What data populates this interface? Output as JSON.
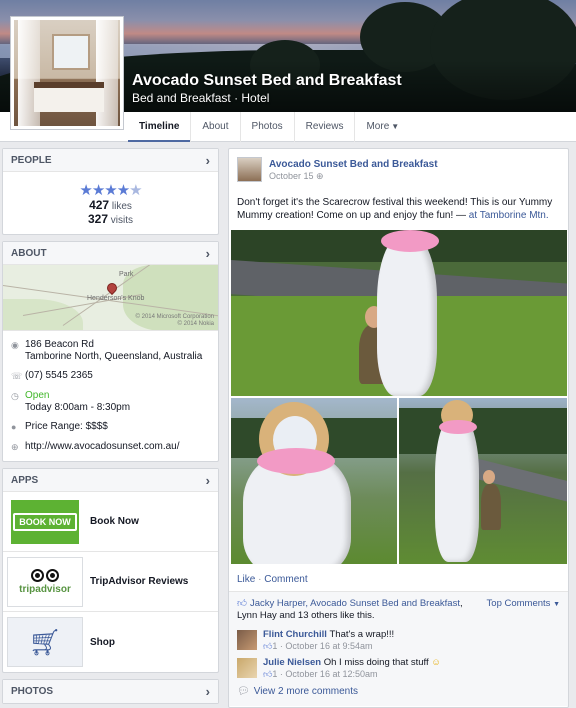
{
  "page": {
    "name": "Avocado Sunset Bed and Breakfast",
    "category": "Bed and Breakfast · Hotel"
  },
  "tabs": [
    "Timeline",
    "About",
    "Photos",
    "Reviews",
    "More"
  ],
  "people": {
    "header": "PEOPLE",
    "rating_stars": 4.5,
    "likes_count": "427",
    "likes_label": "likes",
    "visits_count": "327",
    "visits_label": "visits"
  },
  "about": {
    "header": "ABOUT",
    "map_labels": [
      "Park",
      "Henderson's Knob"
    ],
    "map_copyright": "© 2014 Microsoft Corporation\n© 2014 Nokia",
    "address_line1": "186 Beacon Rd",
    "address_line2": "Tamborine North, Queensland, Australia",
    "phone": "(07) 5545 2365",
    "open_label": "Open",
    "hours": "Today 8:00am - 8:30pm",
    "price_range": "Price Range: $$$$",
    "website": "http://www.avocadosunset.com.au/"
  },
  "apps": {
    "header": "APPS",
    "items": [
      {
        "label": "Book Now",
        "thumb_text": "BOOK NOW",
        "icon": "book-now-icon"
      },
      {
        "label": "TripAdvisor Reviews",
        "thumb_text": "tripadvisor",
        "icon": "tripadvisor-owl-icon"
      },
      {
        "label": "Shop",
        "icon": "shopping-cart-icon"
      }
    ]
  },
  "photos_header": "PHOTOS",
  "post": {
    "author": "Avocado Sunset Bed and Breakfast",
    "date": "October 15",
    "text": "Don't forget it's the Scarecrow festival this weekend! This is our Yummy Mummy creation! Come on up and enjoy the fun! — ",
    "location": "at Tamborine Mtn.",
    "like_action": "Like",
    "comment_action": "Comment",
    "likers_prefix": "Jacky Harper, ",
    "likers_page": "Avocado Sunset Bed and Breakfast",
    "likers_suffix": ", Lynn Hay and 13 others like this.",
    "top_comments": "Top Comments",
    "comments": [
      {
        "name": "Flint Churchill",
        "text": "That's a wrap!!!",
        "likes": "1",
        "time": "October 16 at 9:54am"
      },
      {
        "name": "Julie Nielsen",
        "text": "Oh I miss doing that stuff",
        "likes": "1",
        "time": "October 16 at 12:50am"
      }
    ],
    "view_more": "View 2 more comments"
  },
  "colors": {
    "link": "#3b5998",
    "open_green": "#42b72a",
    "book_now_green": "#5db233",
    "star_blue": "#5b7bd5"
  }
}
